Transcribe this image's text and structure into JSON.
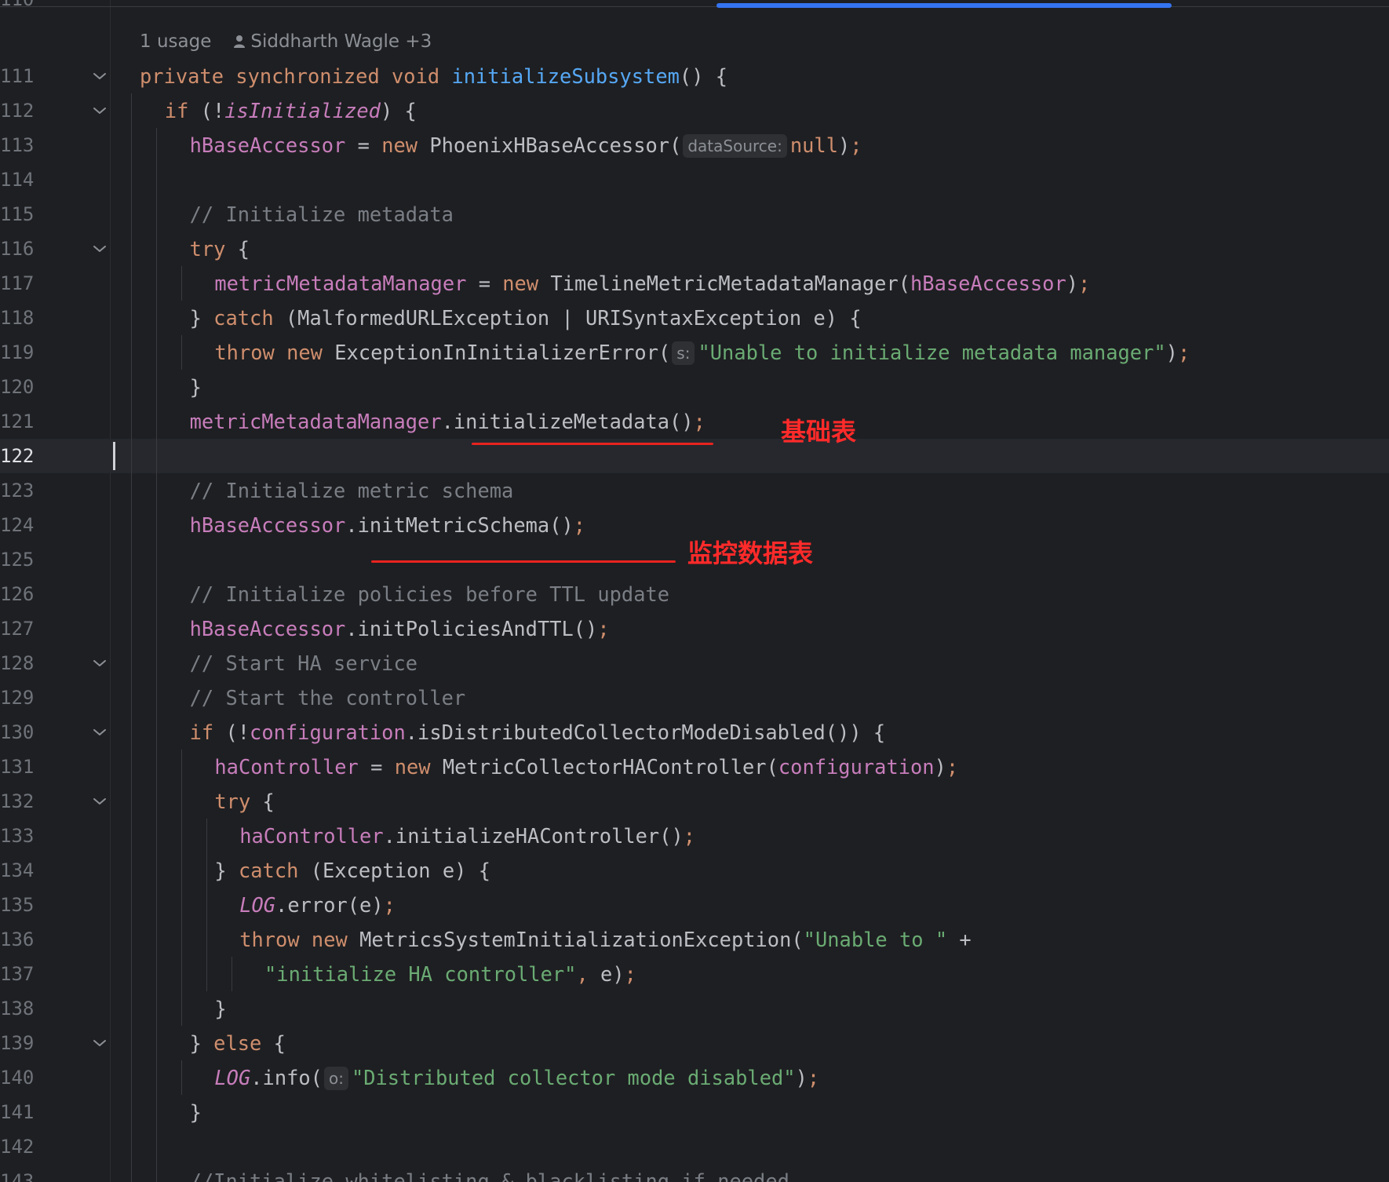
{
  "editor": {
    "usage_hint": "1 usage",
    "author_hint": "Siddharth Wagle +3",
    "first_partial_line_number": "110",
    "current_line": 122,
    "lines": [
      {
        "n": "111",
        "fold": true,
        "indent": 0,
        "tokens": [
          [
            "kw",
            "private synchronized void "
          ],
          [
            "fn",
            "initializeSubsystem"
          ],
          [
            "punc",
            "() {"
          ]
        ]
      },
      {
        "n": "112",
        "fold": true,
        "indent": 1,
        "tokens": [
          [
            "kw",
            "if "
          ],
          [
            "punc",
            "(!"
          ],
          [
            "st",
            "isInitialized"
          ],
          [
            "punc",
            ") {"
          ]
        ]
      },
      {
        "n": "113",
        "fold": false,
        "indent": 2,
        "tokens": [
          [
            "fld",
            "hBaseAccessor"
          ],
          [
            "punc",
            " = "
          ],
          [
            "kw",
            "new "
          ],
          [
            "punc",
            "PhoenixHBaseAccessor("
          ],
          [
            "hint",
            "dataSource:"
          ],
          [
            "kw",
            "null"
          ],
          [
            "punc",
            ")"
          ],
          [
            "semi",
            ";"
          ]
        ]
      },
      {
        "n": "114",
        "fold": false,
        "indent": 2,
        "tokens": []
      },
      {
        "n": "115",
        "fold": false,
        "indent": 2,
        "tokens": [
          [
            "cmt",
            "// Initialize metadata"
          ]
        ]
      },
      {
        "n": "116",
        "fold": true,
        "indent": 2,
        "tokens": [
          [
            "kw",
            "try "
          ],
          [
            "punc",
            "{"
          ]
        ]
      },
      {
        "n": "117",
        "fold": false,
        "indent": 3,
        "tokens": [
          [
            "fld",
            "metricMetadataManager"
          ],
          [
            "punc",
            " = "
          ],
          [
            "kw",
            "new "
          ],
          [
            "punc",
            "TimelineMetricMetadataManager("
          ],
          [
            "fld",
            "hBaseAccessor"
          ],
          [
            "punc",
            ")"
          ],
          [
            "semi",
            ";"
          ]
        ]
      },
      {
        "n": "118",
        "fold": false,
        "indent": 2,
        "tokens": [
          [
            "punc",
            "} "
          ],
          [
            "kw",
            "catch "
          ],
          [
            "punc",
            "(MalformedURLException | URISyntaxException e) {"
          ]
        ]
      },
      {
        "n": "119",
        "fold": false,
        "indent": 3,
        "tokens": [
          [
            "kw",
            "throw new "
          ],
          [
            "punc",
            "ExceptionInInitializerError("
          ],
          [
            "hint",
            "s:"
          ],
          [
            "str",
            "\"Unable to initialize metadata manager\""
          ],
          [
            "punc",
            ")"
          ],
          [
            "semi",
            ";"
          ]
        ]
      },
      {
        "n": "120",
        "fold": false,
        "indent": 2,
        "tokens": [
          [
            "punc",
            "}"
          ]
        ]
      },
      {
        "n": "121",
        "fold": false,
        "indent": 2,
        "tokens": [
          [
            "fld",
            "metricMetadataManager"
          ],
          [
            "punc",
            ".initializeMetadata()"
          ],
          [
            "semi",
            ";"
          ]
        ]
      },
      {
        "n": "122",
        "fold": false,
        "indent": 2,
        "tokens": []
      },
      {
        "n": "123",
        "fold": false,
        "indent": 2,
        "tokens": [
          [
            "cmt",
            "// Initialize metric schema"
          ]
        ]
      },
      {
        "n": "124",
        "fold": false,
        "indent": 2,
        "tokens": [
          [
            "fld",
            "hBaseAccessor"
          ],
          [
            "punc",
            ".initMetricSchema()"
          ],
          [
            "semi",
            ";"
          ]
        ]
      },
      {
        "n": "125",
        "fold": false,
        "indent": 2,
        "tokens": []
      },
      {
        "n": "126",
        "fold": false,
        "indent": 2,
        "tokens": [
          [
            "cmt",
            "// Initialize policies before TTL update"
          ]
        ]
      },
      {
        "n": "127",
        "fold": false,
        "indent": 2,
        "tokens": [
          [
            "fld",
            "hBaseAccessor"
          ],
          [
            "punc",
            ".initPoliciesAndTTL()"
          ],
          [
            "semi",
            ";"
          ]
        ]
      },
      {
        "n": "128",
        "fold": true,
        "indent": 2,
        "tokens": [
          [
            "cmt",
            "// Start HA service"
          ]
        ]
      },
      {
        "n": "129",
        "fold": false,
        "indent": 2,
        "tokens": [
          [
            "cmt",
            "// Start the controller"
          ]
        ]
      },
      {
        "n": "130",
        "fold": true,
        "indent": 2,
        "tokens": [
          [
            "kw",
            "if "
          ],
          [
            "punc",
            "(!"
          ],
          [
            "fld",
            "configuration"
          ],
          [
            "punc",
            ".isDistributedCollectorModeDisabled()) {"
          ]
        ]
      },
      {
        "n": "131",
        "fold": false,
        "indent": 3,
        "tokens": [
          [
            "fld",
            "haController"
          ],
          [
            "punc",
            " = "
          ],
          [
            "kw",
            "new "
          ],
          [
            "punc",
            "MetricCollectorHAController("
          ],
          [
            "fld",
            "configuration"
          ],
          [
            "punc",
            ")"
          ],
          [
            "semi",
            ";"
          ]
        ]
      },
      {
        "n": "132",
        "fold": true,
        "indent": 3,
        "tokens": [
          [
            "kw",
            "try "
          ],
          [
            "punc",
            "{"
          ]
        ]
      },
      {
        "n": "133",
        "fold": false,
        "indent": 4,
        "tokens": [
          [
            "fld",
            "haController"
          ],
          [
            "punc",
            ".initializeHAController()"
          ],
          [
            "semi",
            ";"
          ]
        ]
      },
      {
        "n": "134",
        "fold": false,
        "indent": 3,
        "tokens": [
          [
            "punc",
            "} "
          ],
          [
            "kw",
            "catch "
          ],
          [
            "punc",
            "(Exception e) {"
          ]
        ]
      },
      {
        "n": "135",
        "fold": false,
        "indent": 4,
        "tokens": [
          [
            "st",
            "LOG"
          ],
          [
            "punc",
            ".error(e)"
          ],
          [
            "semi",
            ";"
          ]
        ]
      },
      {
        "n": "136",
        "fold": false,
        "indent": 4,
        "tokens": [
          [
            "kw",
            "throw new "
          ],
          [
            "punc",
            "MetricsSystemInitializationException("
          ],
          [
            "str",
            "\"Unable to \""
          ],
          [
            "punc",
            " +"
          ]
        ]
      },
      {
        "n": "137",
        "fold": false,
        "indent": 5,
        "tokens": [
          [
            "str",
            "\"initialize HA controller\""
          ],
          [
            "semi",
            ", "
          ],
          [
            "punc",
            "e)"
          ],
          [
            "semi",
            ";"
          ]
        ]
      },
      {
        "n": "138",
        "fold": false,
        "indent": 3,
        "tokens": [
          [
            "punc",
            "}"
          ]
        ]
      },
      {
        "n": "139",
        "fold": true,
        "indent": 2,
        "tokens": [
          [
            "punc",
            "} "
          ],
          [
            "kw",
            "else "
          ],
          [
            "punc",
            "{"
          ]
        ]
      },
      {
        "n": "140",
        "fold": false,
        "indent": 3,
        "tokens": [
          [
            "st",
            "LOG"
          ],
          [
            "punc",
            ".info("
          ],
          [
            "hint",
            "o:"
          ],
          [
            "str",
            "\"Distributed collector mode disabled\""
          ],
          [
            "punc",
            ")"
          ],
          [
            "semi",
            ";"
          ]
        ]
      },
      {
        "n": "141",
        "fold": false,
        "indent": 2,
        "tokens": [
          [
            "punc",
            "}"
          ]
        ]
      },
      {
        "n": "142",
        "fold": false,
        "indent": 2,
        "tokens": []
      },
      {
        "n": "143",
        "fold": false,
        "indent": 2,
        "tokens": [
          [
            "cmt",
            "//Initialize whitelisting & blacklisting if needed"
          ]
        ]
      }
    ]
  },
  "annotations": {
    "basic_table": "基础表",
    "monitoring_table": "监控数据表"
  },
  "colors": {
    "background": "#1e1f22",
    "keyword": "#cf8e6d",
    "field": "#c77dbb",
    "string": "#6aab73",
    "comment": "#7a7e85",
    "annotation": "#ff2a2a",
    "scroll_thumb": "#3574f0"
  }
}
